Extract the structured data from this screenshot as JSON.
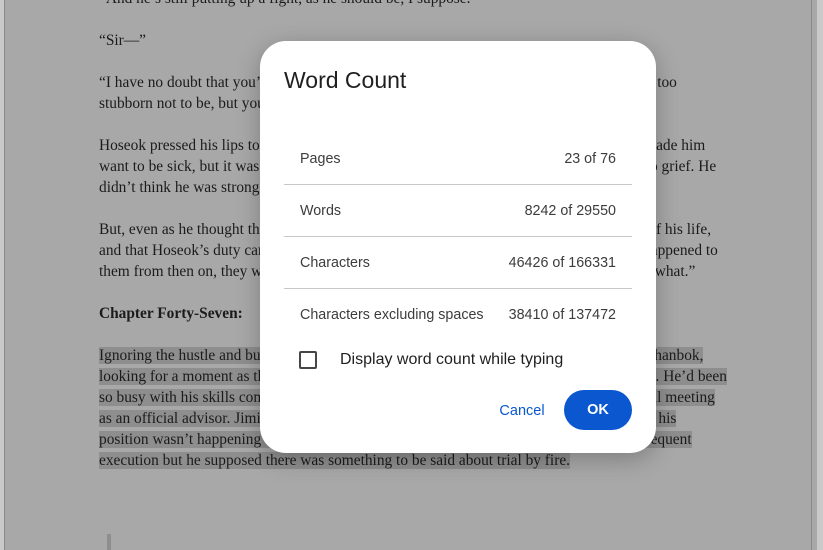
{
  "document": {
    "paragraphs": [
      {
        "kind": "p",
        "text": "“And he’s still putting up a fight, as he should be, I suppose.”"
      },
      {
        "kind": "p",
        "text": "“Sir—”"
      },
      {
        "kind": "p",
        "text": "“I have no doubt that you’d be loyal to Sungki until the end,” Hoseok interrupted, “you’re too stubborn not to be, but you have to remember you have a duty too.”"
      },
      {
        "kind": "p",
        "text": "Hoseok pressed his lips together. The thought of being there when Yoongi was executed made him want to be sick, but it was worse to think that he’d then have to watch Sungki descend into grief. He didn’t think he was strong enough to stand by while that happened."
      },
      {
        "kind": "p",
        "text": "But, even as he thought this, he knew Yoongi would want to see friendly faces at the end of his life, and that Hoseok’s duty came before his own selfish desires, and he knew that, whatever happened to them from then on, they weren’t alone, but they’d be watching, and he’d be doing exactly what.”"
      },
      {
        "kind": "h",
        "text": "Chapter Forty-Seven:"
      },
      {
        "kind": "sel",
        "text": "Ignoring the hustle and bustle around him, Jimin smoothed his hand down the front of his hanbok, looking for a moment as though he’d held the role of Sungki’s advisor for quite some time. He’d been so busy with his skills competition that he’d never actually had a chance to attend a council meeting as an official advisor. Jimin couldn’t help but wish that his first introduction to that side of his position wasn’t happening when the topic of conversation was Yoongi’s treatson and subsequent execution but he supposed there was something to be said about trial by fire."
      }
    ]
  },
  "dialog": {
    "title": "Word Count",
    "stats": [
      {
        "label": "Pages",
        "value": "23 of 76"
      },
      {
        "label": "Words",
        "value": "8242 of 29550"
      },
      {
        "label": "Characters",
        "value": "46426 of 166331"
      },
      {
        "label": "Characters excluding spaces",
        "value": "38410 of 137472"
      }
    ],
    "checkbox_label": "Display word count while typing",
    "checkbox_checked": false,
    "cancel_label": "Cancel",
    "ok_label": "OK"
  },
  "colors": {
    "accent": "#0b57d0",
    "overlay": "#a8a8a8",
    "selection": "#8e8e8e"
  }
}
